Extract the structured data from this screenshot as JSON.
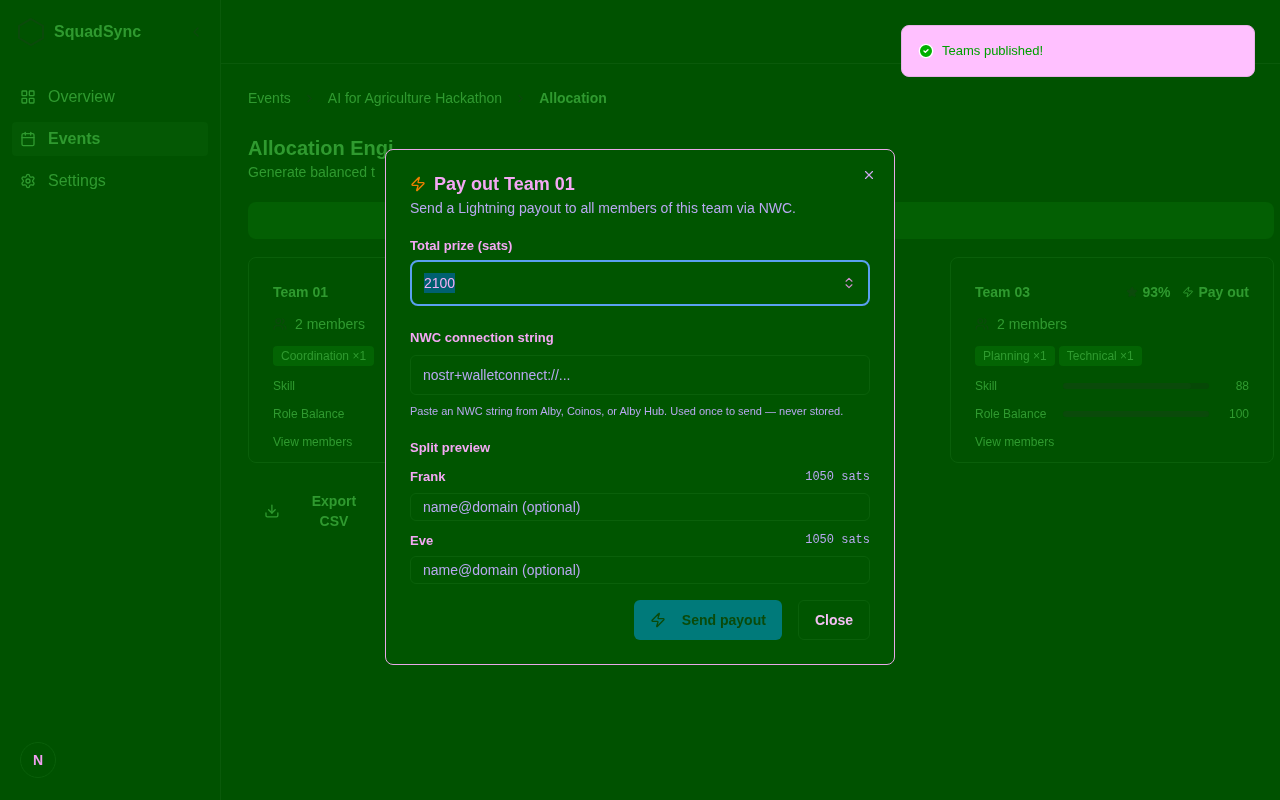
{
  "sidebar": {
    "logo": "SquadSync",
    "items": [
      {
        "label": "Overview",
        "selected": false
      },
      {
        "label": "Events",
        "selected": true
      },
      {
        "label": "Settings",
        "selected": false
      }
    ]
  },
  "breadcrumb": [
    "Events",
    "AI for Agriculture Hackathon",
    "Allocation"
  ],
  "page": {
    "title": "Allocation Engi",
    "subtitle": "Generate balanced t"
  },
  "team_card": {
    "name": "Team 01",
    "members": "2 members",
    "tags": [
      "Coordination ×1"
    ],
    "metrics": [
      "Skill",
      "Role Balance"
    ],
    "view_members": "View members"
  },
  "team_card_2": {
    "name": "Team 03",
    "score": "93%",
    "payout": "Pay out",
    "members": "2 members",
    "tags": [
      "Planning ×1",
      "Technical ×1"
    ],
    "metrics": [
      {
        "label": "Skill",
        "value": "88",
        "level": 0.88
      },
      {
        "label": "Role Balance",
        "value": "100",
        "level": 1
      }
    ],
    "view_members": "View members"
  },
  "export_button": "Export CSV",
  "toast": {
    "message": "Teams published!"
  },
  "dialog": {
    "title": "Pay out Team 01",
    "description": "Send a Lightning payout to all members of this team via NWC.",
    "prize": {
      "label": "Total prize (sats)",
      "value": "2100"
    },
    "nwc": {
      "label": "NWC connection string",
      "placeholder": "nostr+walletconnect://...",
      "hint": "Paste an NWC string from Alby, Coinos, or Alby Hub. Used once to send — never stored."
    },
    "split_title": "Split preview",
    "members": [
      {
        "name": "Frank",
        "amount": "1050 sats",
        "placeholder": "name@domain (optional)"
      },
      {
        "name": "Eve",
        "amount": "1050 sats",
        "placeholder": "name@domain (optional)"
      }
    ],
    "buttons": {
      "send": "Send payout",
      "close": "Close"
    }
  },
  "dev_badge": "N"
}
